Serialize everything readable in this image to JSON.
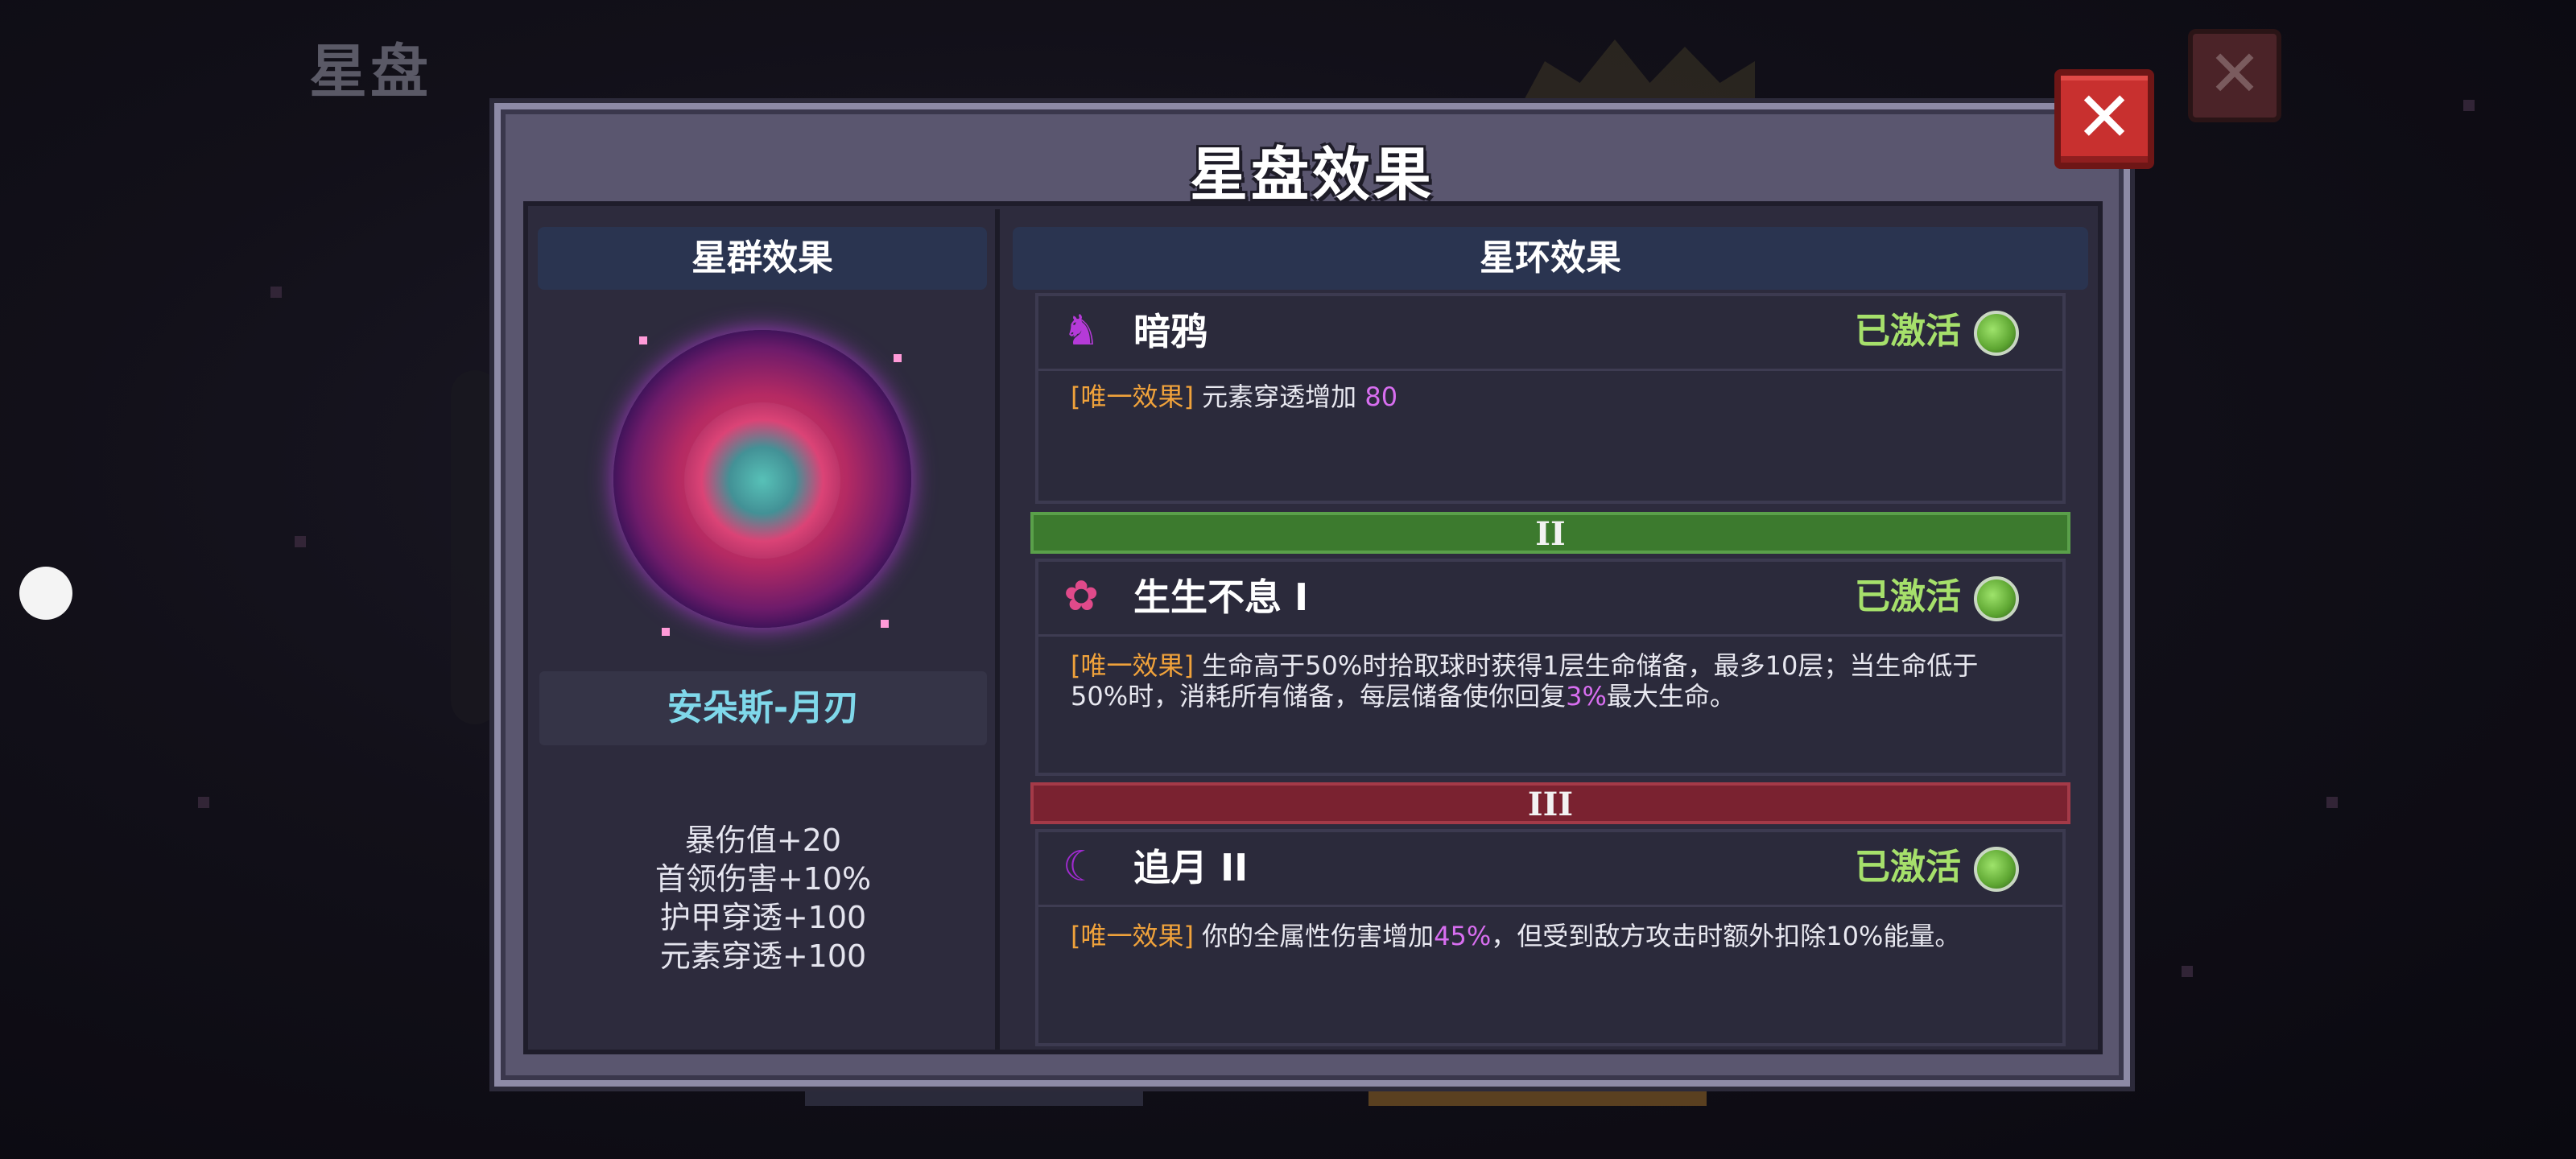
{
  "background": {
    "title": "星盘"
  },
  "dialog": {
    "title": "星盘效果",
    "left_panel": {
      "header": "星群效果",
      "constellation_name": "安朵斯-月刃",
      "stats": [
        "暴伤值+20",
        "首领伤害+10%",
        "护甲穿透+100",
        "元素穿透+100"
      ]
    },
    "right_panel": {
      "header": "星环效果",
      "effects": [
        {
          "name": "暗鸦",
          "status": "已激活",
          "tag": "[唯一效果]",
          "desc_pre": " 元素穿透增加 ",
          "desc_hl": "80",
          "desc_post": ""
        },
        {
          "tier": "II",
          "name": "生生不息 I",
          "status": "已激活",
          "tag": "[唯一效果]",
          "desc_pre": " 生命高于50%时拾取球时获得1层生命储备，最多10层；当生命低于50%时，消耗所有储备，每层储备使你回复",
          "desc_hl": "3%",
          "desc_post": "最大生命。"
        },
        {
          "tier": "III",
          "name": "追月 II",
          "status": "已激活",
          "tag": "[唯一效果]",
          "desc_pre": " 你的全属性伤害增加",
          "desc_hl": "45%",
          "desc_post": "，但受到敌方攻击时额外扣除10%能量。"
        }
      ]
    }
  },
  "colors": {
    "status_active": "#a6e06b",
    "tag": "#f0a23b",
    "highlight": "#d86ef0",
    "name_plate": "#7fd8ea",
    "close": "#c8302f"
  }
}
